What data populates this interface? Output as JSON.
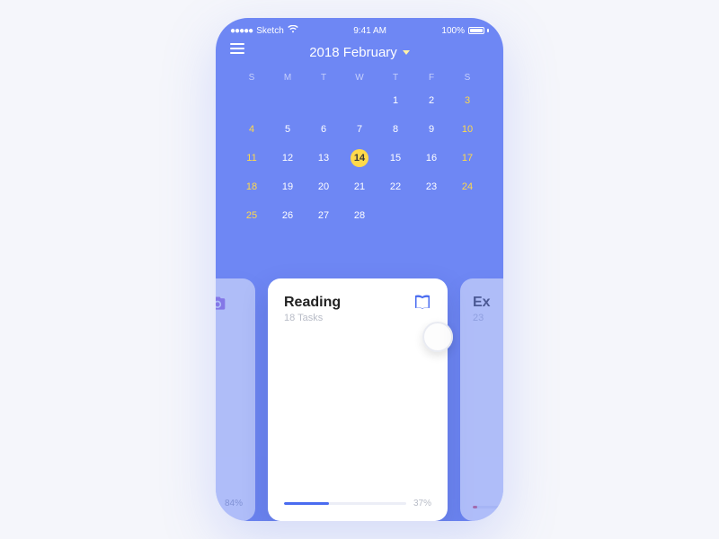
{
  "statusbar": {
    "carrier": "Sketch",
    "time": "9:41 AM",
    "battery": "100%"
  },
  "header": {
    "title": "2018 February"
  },
  "calendar": {
    "weekdays": [
      "S",
      "M",
      "T",
      "W",
      "T",
      "F",
      "S"
    ],
    "rows": [
      [
        null,
        null,
        null,
        null,
        "1",
        "2",
        "3"
      ],
      [
        "4",
        "5",
        "6",
        "7",
        "8",
        "9",
        "10"
      ],
      [
        "11",
        "12",
        "13",
        "14",
        "15",
        "16",
        "17"
      ],
      [
        "18",
        "19",
        "20",
        "21",
        "22",
        "23",
        "24"
      ],
      [
        "25",
        "26",
        "27",
        "28",
        null,
        null,
        null
      ]
    ],
    "selected": "14"
  },
  "cards": {
    "left": {
      "percent_label": "84%"
    },
    "center": {
      "title": "Reading",
      "subtitle": "18 Tasks",
      "percent": 37,
      "percent_label": "37%"
    },
    "right": {
      "title": "Ex",
      "subtitle": "23",
      "percent": 10
    }
  }
}
